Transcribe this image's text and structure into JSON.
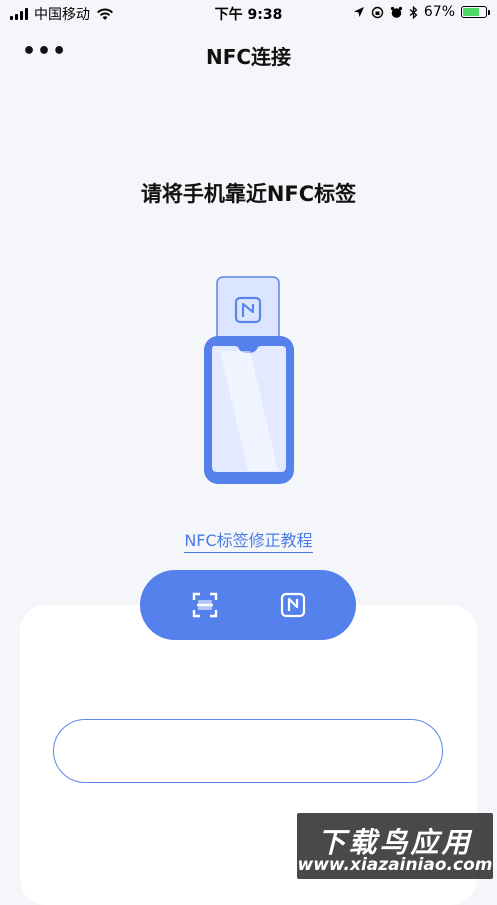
{
  "status_bar": {
    "carrier": "中国移动",
    "time": "下午 9:38",
    "battery": "67%",
    "battery_level": 0.67
  },
  "nav": {
    "more": "•••",
    "title": "NFC连接"
  },
  "main": {
    "prompt": "请将手机靠近NFC标签",
    "tutorial_link": "NFC标签修正教程"
  },
  "mode_switch": {
    "modes": [
      "scan-icon",
      "nfc-icon"
    ]
  },
  "input": {
    "value": ""
  },
  "watermark": {
    "title": "下载鸟应用",
    "url": "www.xiazainiao.com"
  },
  "colors": {
    "accent": "#5581ec",
    "link": "#4a7ce8",
    "background": "#f5f6fa"
  }
}
